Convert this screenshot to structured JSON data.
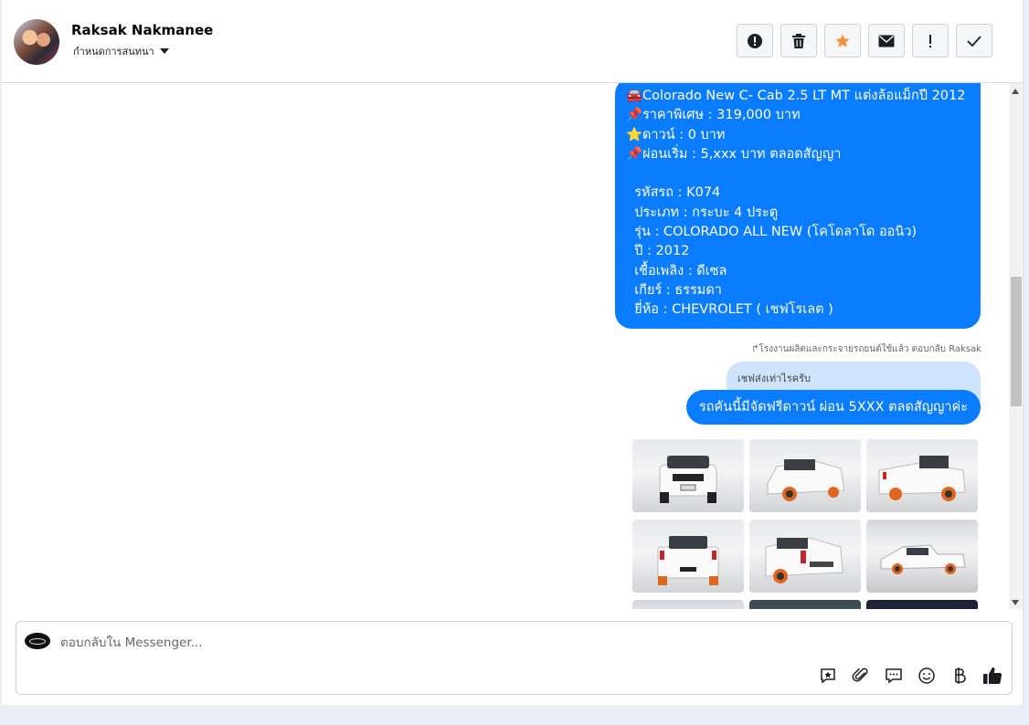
{
  "header": {
    "contact_name": "Raksak Nakmanee",
    "assign_label": "กำหนดการสนทนา",
    "actions": [
      {
        "name": "report-spam",
        "icon": "exclamation-circle-icon"
      },
      {
        "name": "delete",
        "icon": "trash-icon"
      },
      {
        "name": "star",
        "icon": "star-icon",
        "color": "#f7923b"
      },
      {
        "name": "mark-unread",
        "icon": "envelope-icon"
      },
      {
        "name": "important",
        "icon": "exclamation-icon"
      },
      {
        "name": "mark-done",
        "icon": "check-icon"
      }
    ]
  },
  "messages": {
    "listing_lines": [
      {
        "icon": "car-emoji",
        "glyph": "🚘",
        "text": "Colorado New C- Cab 2.5 LT MT แต่งล้อแม็กปี 2012"
      },
      {
        "icon": "pushpin-emoji",
        "glyph": "📌",
        "text": "ราคาพิเศษ : 319,000 บาท"
      },
      {
        "icon": "star-emoji",
        "glyph": "⭐",
        "text": "ดาวน์ : 0 บาท"
      },
      {
        "icon": "pushpin-emoji",
        "glyph": "📌",
        "text": "ผ่อนเริ่ม : 5,xxx บาท ตลอดสัญญา"
      },
      {
        "icon": "",
        "glyph": "",
        "text": ""
      },
      {
        "icon": "",
        "glyph": "",
        "text": "รหัสรถ : K074"
      },
      {
        "icon": "",
        "glyph": "",
        "text": "ประเภท : กระบะ 4 ประตู"
      },
      {
        "icon": "",
        "glyph": "",
        "text": "รุ่น : COLORADO ALL NEW (โคโดลาโด ออนิว)"
      },
      {
        "icon": "",
        "glyph": "",
        "text": "ปี : 2012"
      },
      {
        "icon": "",
        "glyph": "",
        "text": "เชื้อเพลิง : ดีเซล"
      },
      {
        "icon": "",
        "glyph": "",
        "text": "เกียร์ : ธรรมดา"
      },
      {
        "icon": "",
        "glyph": "",
        "text": "ยี่ห้อ : CHEVROLET ( เชฟโรเลต )"
      }
    ],
    "reply_meta": "โรงงานผลิตและกระจายรถยนต์ใช้แล้ว ตอบกลับ Raksak",
    "quoted_text": "เชฟส่งเท่าไรครับ",
    "answer_text": "รถคันนี้มีจัดฟรีดาวน์ ผ่อน 5XXX ตลดสัญญาค่ะ",
    "photos": [
      {
        "view": "front"
      },
      {
        "view": "front-left"
      },
      {
        "view": "rear-right"
      },
      {
        "view": "rear"
      },
      {
        "view": "rear-left"
      },
      {
        "view": "side"
      },
      {
        "view": "studio"
      },
      {
        "view": "studio"
      },
      {
        "view": "screenshot"
      }
    ]
  },
  "composer": {
    "placeholder": "ตอบกลับใน Messenger...",
    "tools": [
      {
        "name": "saved-reply",
        "icon": "saved-reply-icon"
      },
      {
        "name": "attach",
        "icon": "paperclip-icon"
      },
      {
        "name": "chat",
        "icon": "speech-bubble-icon"
      },
      {
        "name": "emoji",
        "icon": "smiley-icon"
      },
      {
        "name": "payment",
        "icon": "baht-icon"
      },
      {
        "name": "like",
        "icon": "thumbs-up-icon"
      }
    ]
  },
  "colors": {
    "bubble_blue": "#0a7cff",
    "quoted_bg": "#cfe4fc",
    "star_orange": "#f7923b"
  }
}
